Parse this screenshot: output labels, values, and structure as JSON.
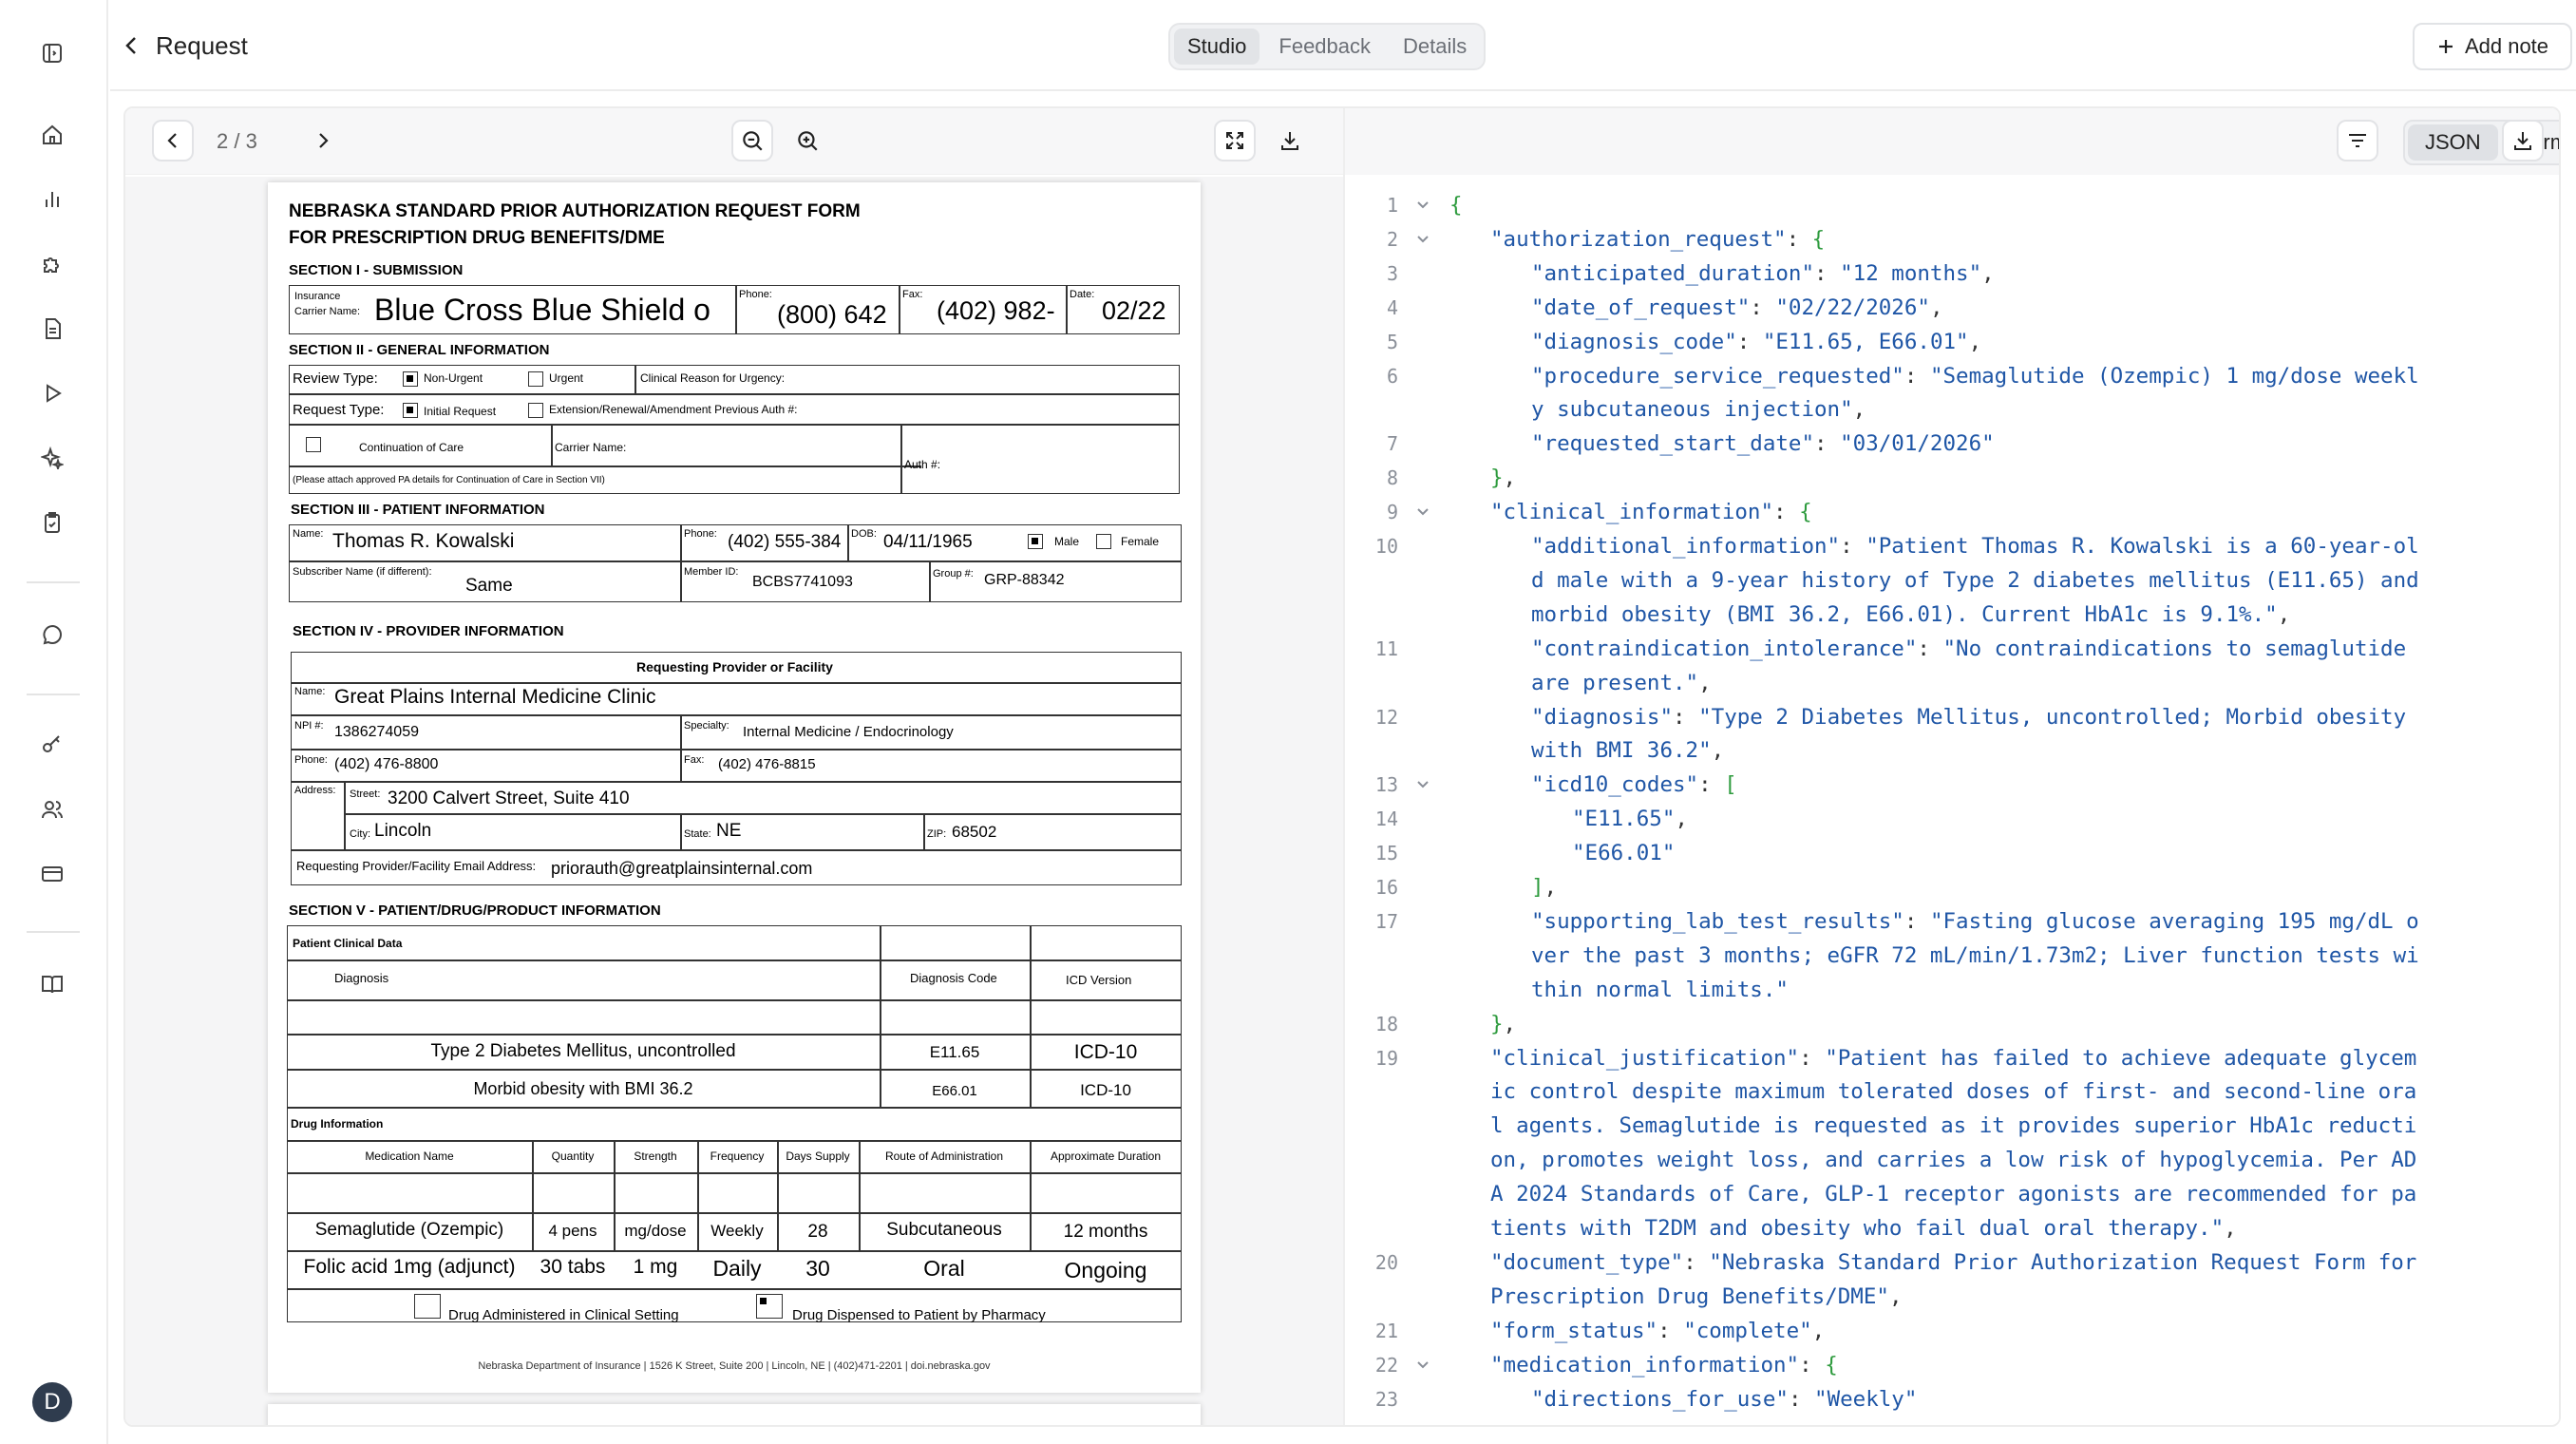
{
  "header": {
    "back_label": "Request",
    "tabs": [
      {
        "label": "Studio",
        "active": true
      },
      {
        "label": "Feedback",
        "active": false
      },
      {
        "label": "Details",
        "active": false
      }
    ],
    "add_note_label": "Add note"
  },
  "sidebar": {
    "icons": [
      "sidebar-toggle-icon",
      "home-icon",
      "bar-chart-icon",
      "puzzle-icon",
      "document-icon",
      "play-icon",
      "sparkles-icon",
      "clipboard-check-icon",
      "chat-bubble-icon",
      "key-icon",
      "users-icon",
      "credit-card-icon",
      "book-icon"
    ],
    "avatar_initial": "D"
  },
  "viewer": {
    "pager": "2 / 3",
    "view_modes": [
      "JSON",
      "Form"
    ],
    "active_mode": "JSON"
  },
  "form": {
    "title_line1": "NEBRASKA STANDARD PRIOR AUTHORIZATION REQUEST FORM",
    "title_line2": "FOR PRESCRIPTION DRUG BENEFITS/DME",
    "s1": "SECTION I - SUBMISSION",
    "insurance_label_1": "Insurance",
    "insurance_label_2": "Carrier Name:",
    "carrier_name": "Blue Cross Blue Shield o",
    "phone_label": "Phone:",
    "phone": "(800) 642",
    "fax_label": "Fax:",
    "fax": "(402) 982-",
    "date_label": "Date:",
    "date": "02/22",
    "s2": "SECTION II - GENERAL INFORMATION",
    "review_type_label": "Review Type:",
    "non_urgent": "Non-Urgent",
    "urgent": "Urgent",
    "clinical_reason": "Clinical Reason for Urgency:",
    "request_type_label": "Request Type:",
    "initial_request": "Initial Request",
    "extension": "Extension/Renewal/Amendment Previous Auth #:",
    "continuation": "Continuation of Care",
    "carrier_name_label": "Carrier Name:",
    "auth_label": "Auth #:",
    "attach_note": "(Please attach approved PA details for Continuation of Care in Section VII)",
    "s3": "SECTION III - PATIENT INFORMATION",
    "name_label": "Name:",
    "patient_name": "Thomas R. Kowalski",
    "patient_phone_label": "Phone:",
    "patient_phone": "(402) 555-384",
    "dob_label": "DOB:",
    "dob": "04/11/1965",
    "male": "Male",
    "female": "Female",
    "subscriber_label": "Subscriber Name (if different):",
    "subscriber": "Same",
    "member_label": "Member ID:",
    "member_id": "BCBS7741093",
    "group_label": "Group #:",
    "group": "GRP-88342",
    "s4": "SECTION IV - PROVIDER INFORMATION",
    "provider_header": "Requesting Provider or Facility",
    "provider_name_label": "Name:",
    "provider_name": "Great Plains Internal Medicine Clinic",
    "npi_label": "NPI #:",
    "npi": "1386274059",
    "specialty_label": "Specialty:",
    "specialty": "Internal Medicine / Endocrinology",
    "prov_phone_label": "Phone:",
    "prov_phone": "(402) 476-8800",
    "prov_fax_label": "Fax:",
    "prov_fax": "(402) 476-8815",
    "address_label": "Address:",
    "street_label": "Street:",
    "street": "3200 Calvert Street, Suite 410",
    "city_label": "City:",
    "city": "Lincoln",
    "state_label": "State:",
    "state": "NE",
    "zip_label": "ZIP:",
    "zip": "68502",
    "email_label": "Requesting Provider/Facility Email Address:",
    "email": "priorauth@greatplainsinternal.com",
    "s5": "SECTION V - PATIENT/DRUG/PRODUCT INFORMATION",
    "clinical_data_label": "Patient Clinical Data",
    "diagnosis_col": "Diagnosis",
    "diagnosis_code_col": "Diagnosis Code",
    "icd_version_col": "ICD Version",
    "diagnoses": [
      {
        "diagnosis": "Type 2 Diabetes Mellitus, uncontrolled",
        "code": "E11.65",
        "icd": "ICD-10"
      },
      {
        "diagnosis": "Morbid obesity with BMI 36.2",
        "code": "E66.01",
        "icd": "ICD-10"
      }
    ],
    "drug_info_label": "Drug Information",
    "drug_cols": [
      "Medication Name",
      "Quantity",
      "Strength",
      "Frequency",
      "Days Supply",
      "Route of Administration",
      "Approximate Duration"
    ],
    "drugs": [
      {
        "name": "Semaglutide (Ozempic)",
        "qty": "4 pens",
        "strength": "mg/dose",
        "freq": "Weekly",
        "days": "28",
        "route": "Subcutaneous",
        "duration": "12 months"
      },
      {
        "name": "Folic acid 1mg (adjunct)",
        "qty": "30 tabs",
        "strength": "1 mg",
        "freq": "Daily",
        "days": "30",
        "route": "Oral",
        "duration": "Ongoing"
      }
    ],
    "administered": "Drug Administered in Clinical Setting",
    "dispensed": "Drug Dispensed to Patient by Pharmacy",
    "footer": "Nebraska Department of Insurance | 1526 K Street, Suite 200 | Lincoln, NE | (402)471-2201 | doi.nebraska.gov"
  },
  "json_lines": [
    {
      "n": "1",
      "fold": true,
      "indent": 0,
      "parts": [
        {
          "t": "{",
          "c": "p"
        }
      ]
    },
    {
      "n": "2",
      "fold": true,
      "indent": 1,
      "parts": [
        {
          "t": "\"authorization_request\"",
          "c": "k"
        },
        {
          "t": ": ",
          "c": "n"
        },
        {
          "t": "{",
          "c": "p"
        }
      ]
    },
    {
      "n": "3",
      "indent": 2,
      "parts": [
        {
          "t": "\"anticipated_duration\"",
          "c": "k"
        },
        {
          "t": ": ",
          "c": "n"
        },
        {
          "t": "\"12 months\"",
          "c": "s"
        },
        {
          "t": ",",
          "c": "n"
        }
      ]
    },
    {
      "n": "4",
      "indent": 2,
      "parts": [
        {
          "t": "\"date_of_request\"",
          "c": "k"
        },
        {
          "t": ": ",
          "c": "n"
        },
        {
          "t": "\"02/22/2026\"",
          "c": "s"
        },
        {
          "t": ",",
          "c": "n"
        }
      ]
    },
    {
      "n": "5",
      "indent": 2,
      "parts": [
        {
          "t": "\"diagnosis_code\"",
          "c": "k"
        },
        {
          "t": ": ",
          "c": "n"
        },
        {
          "t": "\"E11.65, E66.01\"",
          "c": "s"
        },
        {
          "t": ",",
          "c": "n"
        }
      ]
    },
    {
      "n": "6",
      "indent": 2,
      "parts": [
        {
          "t": "\"procedure_service_requested\"",
          "c": "k"
        },
        {
          "t": ": ",
          "c": "n"
        },
        {
          "t": "\"Semaglutide (Ozempic) 1 mg/dose weekl",
          "c": "s"
        }
      ]
    },
    {
      "n": "",
      "indent": 2,
      "parts": [
        {
          "t": "y subcutaneous injection\"",
          "c": "s"
        },
        {
          "t": ",",
          "c": "n"
        }
      ]
    },
    {
      "n": "7",
      "indent": 2,
      "parts": [
        {
          "t": "\"requested_start_date\"",
          "c": "k"
        },
        {
          "t": ": ",
          "c": "n"
        },
        {
          "t": "\"03/01/2026\"",
          "c": "s"
        }
      ]
    },
    {
      "n": "8",
      "indent": 1,
      "parts": [
        {
          "t": "}",
          "c": "p"
        },
        {
          "t": ",",
          "c": "n"
        }
      ]
    },
    {
      "n": "9",
      "fold": true,
      "indent": 1,
      "parts": [
        {
          "t": "\"clinical_information\"",
          "c": "k"
        },
        {
          "t": ": ",
          "c": "n"
        },
        {
          "t": "{",
          "c": "p"
        }
      ]
    },
    {
      "n": "10",
      "indent": 2,
      "parts": [
        {
          "t": "\"additional_information\"",
          "c": "k"
        },
        {
          "t": ": ",
          "c": "n"
        },
        {
          "t": "\"Patient Thomas R. Kowalski is a 60-year-ol",
          "c": "s"
        }
      ]
    },
    {
      "n": "",
      "indent": 2,
      "parts": [
        {
          "t": "d male with a 9-year history of Type 2 diabetes mellitus (E11.65) and",
          "c": "s"
        }
      ]
    },
    {
      "n": "",
      "indent": 2,
      "parts": [
        {
          "t": "morbid obesity (BMI 36.2, E66.01). Current HbA1c is 9.1%.\"",
          "c": "s"
        },
        {
          "t": ",",
          "c": "n"
        }
      ]
    },
    {
      "n": "11",
      "indent": 2,
      "parts": [
        {
          "t": "\"contraindication_intolerance\"",
          "c": "k"
        },
        {
          "t": ": ",
          "c": "n"
        },
        {
          "t": "\"No contraindications to semaglutide",
          "c": "s"
        }
      ]
    },
    {
      "n": "",
      "indent": 2,
      "parts": [
        {
          "t": "are present.\"",
          "c": "s"
        },
        {
          "t": ",",
          "c": "n"
        }
      ]
    },
    {
      "n": "12",
      "indent": 2,
      "parts": [
        {
          "t": "\"diagnosis\"",
          "c": "k"
        },
        {
          "t": ": ",
          "c": "n"
        },
        {
          "t": "\"Type 2 Diabetes Mellitus, uncontrolled; Morbid obesity",
          "c": "s"
        }
      ]
    },
    {
      "n": "",
      "indent": 2,
      "parts": [
        {
          "t": "with BMI 36.2\"",
          "c": "s"
        },
        {
          "t": ",",
          "c": "n"
        }
      ]
    },
    {
      "n": "13",
      "fold": true,
      "indent": 2,
      "parts": [
        {
          "t": "\"icd10_codes\"",
          "c": "k"
        },
        {
          "t": ": ",
          "c": "n"
        },
        {
          "t": "[",
          "c": "p"
        }
      ]
    },
    {
      "n": "14",
      "indent": 3,
      "parts": [
        {
          "t": "\"E11.65\"",
          "c": "s"
        },
        {
          "t": ",",
          "c": "n"
        }
      ]
    },
    {
      "n": "15",
      "indent": 3,
      "parts": [
        {
          "t": "\"E66.01\"",
          "c": "s"
        }
      ]
    },
    {
      "n": "16",
      "indent": 2,
      "parts": [
        {
          "t": "]",
          "c": "p"
        },
        {
          "t": ",",
          "c": "n"
        }
      ]
    },
    {
      "n": "17",
      "indent": 2,
      "parts": [
        {
          "t": "\"supporting_lab_test_results\"",
          "c": "k"
        },
        {
          "t": ": ",
          "c": "n"
        },
        {
          "t": "\"Fasting glucose averaging 195 mg/dL o",
          "c": "s"
        }
      ]
    },
    {
      "n": "",
      "indent": 2,
      "parts": [
        {
          "t": "ver the past 3 months; eGFR 72 mL/min/1.73m2; Liver function tests wi",
          "c": "s"
        }
      ]
    },
    {
      "n": "",
      "indent": 2,
      "parts": [
        {
          "t": "thin normal limits.\"",
          "c": "s"
        }
      ]
    },
    {
      "n": "18",
      "indent": 1,
      "parts": [
        {
          "t": "}",
          "c": "p"
        },
        {
          "t": ",",
          "c": "n"
        }
      ]
    },
    {
      "n": "19",
      "indent": 1,
      "parts": [
        {
          "t": "\"clinical_justification\"",
          "c": "k"
        },
        {
          "t": ": ",
          "c": "n"
        },
        {
          "t": "\"Patient has failed to achieve adequate glycem",
          "c": "s"
        }
      ]
    },
    {
      "n": "",
      "indent": 1,
      "parts": [
        {
          "t": "ic control despite maximum tolerated doses of first- and second-line ora",
          "c": "s"
        }
      ]
    },
    {
      "n": "",
      "indent": 1,
      "parts": [
        {
          "t": "l agents. Semaglutide is requested as it provides superior HbA1c reducti",
          "c": "s"
        }
      ]
    },
    {
      "n": "",
      "indent": 1,
      "parts": [
        {
          "t": "on, promotes weight loss, and carries a low risk of hypoglycemia. Per AD",
          "c": "s"
        }
      ]
    },
    {
      "n": "",
      "indent": 1,
      "parts": [
        {
          "t": "A 2024 Standards of Care, GLP-1 receptor agonists are recommended for pa",
          "c": "s"
        }
      ]
    },
    {
      "n": "",
      "indent": 1,
      "parts": [
        {
          "t": "tients with T2DM and obesity who fail dual oral therapy.\"",
          "c": "s"
        },
        {
          "t": ",",
          "c": "n"
        }
      ]
    },
    {
      "n": "20",
      "indent": 1,
      "parts": [
        {
          "t": "\"document_type\"",
          "c": "k"
        },
        {
          "t": ": ",
          "c": "n"
        },
        {
          "t": "\"Nebraska Standard Prior Authorization Request Form for",
          "c": "s"
        }
      ]
    },
    {
      "n": "",
      "indent": 1,
      "parts": [
        {
          "t": "Prescription Drug Benefits/DME\"",
          "c": "s"
        },
        {
          "t": ",",
          "c": "n"
        }
      ]
    },
    {
      "n": "21",
      "indent": 1,
      "parts": [
        {
          "t": "\"form_status\"",
          "c": "k"
        },
        {
          "t": ": ",
          "c": "n"
        },
        {
          "t": "\"complete\"",
          "c": "s"
        },
        {
          "t": ",",
          "c": "n"
        }
      ]
    },
    {
      "n": "22",
      "fold": true,
      "indent": 1,
      "parts": [
        {
          "t": "\"medication_information\"",
          "c": "k"
        },
        {
          "t": ": ",
          "c": "n"
        },
        {
          "t": "{",
          "c": "p"
        }
      ]
    },
    {
      "n": "23",
      "indent": 2,
      "parts": [
        {
          "t": "\"directions_for_use\"",
          "c": "k"
        },
        {
          "t": ": ",
          "c": "n"
        },
        {
          "t": "\"Weekly\"",
          "c": "s"
        }
      ]
    }
  ]
}
